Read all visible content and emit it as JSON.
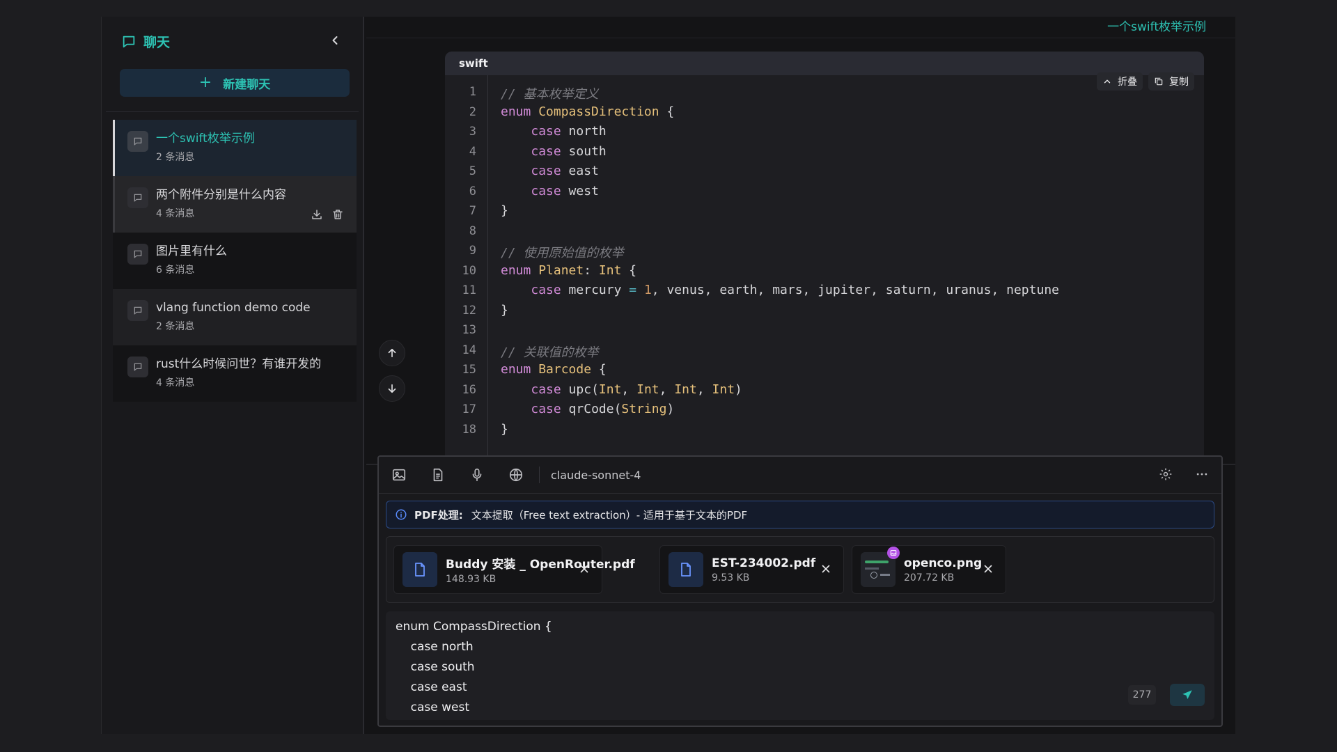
{
  "sidebar": {
    "title": "聊天",
    "new_chat_label": "新建聊天",
    "chats": [
      {
        "title": "一个swift枚举示例",
        "count": "2 条消息"
      },
      {
        "title": "两个附件分别是什么内容",
        "count": "4 条消息"
      },
      {
        "title": "图片里有什么",
        "count": "6 条消息"
      },
      {
        "title": "vlang function demo code",
        "count": "2 条消息"
      },
      {
        "title": "rust什么时候问世？有谁开发的",
        "count": "4 条消息"
      }
    ]
  },
  "main": {
    "conversation_title": "一个swift枚举示例"
  },
  "code_block": {
    "language": "swift",
    "fold_label": "折叠",
    "copy_label": "复制",
    "line_numbers": [
      "1",
      "2",
      "3",
      "4",
      "5",
      "6",
      "7",
      "8",
      "9",
      "10",
      "11",
      "12",
      "13",
      "14",
      "15",
      "16",
      "17",
      "18"
    ]
  },
  "composer": {
    "model": "claude-sonnet-4",
    "pdf_label": "PDF处理:",
    "pdf_text": "文本提取（Free text extraction）- 适用于基于文本的PDF",
    "attachments": [
      {
        "name": "Buddy 安装 _ OpenRouter.pdf",
        "size": "148.93 KB",
        "type": "pdf"
      },
      {
        "name": "EST-234002.pdf",
        "size": "9.53 KB",
        "type": "pdf"
      },
      {
        "name": "openco.png",
        "size": "207.72 KB",
        "type": "image"
      }
    ],
    "input_lines": [
      "enum CompassDirection {",
      "    case north",
      "    case south",
      "    case east",
      "    case west"
    ],
    "char_count": "277"
  },
  "colors": {
    "accent": "#2dc2b3",
    "background": "#141416",
    "sidebar": "#19191c",
    "info_border": "#2b4a86",
    "image_badge": "#b351e6"
  },
  "icons": [
    "chat-bubble-icon",
    "chevron-left-icon",
    "plus-icon",
    "download-icon",
    "trash-icon",
    "arrow-up-icon",
    "arrow-down-icon",
    "chevron-up-icon",
    "copy-icon",
    "image-icon",
    "document-icon",
    "microphone-icon",
    "globe-icon",
    "gear-icon",
    "more-icon",
    "info-icon",
    "file-icon",
    "close-icon",
    "send-icon"
  ]
}
